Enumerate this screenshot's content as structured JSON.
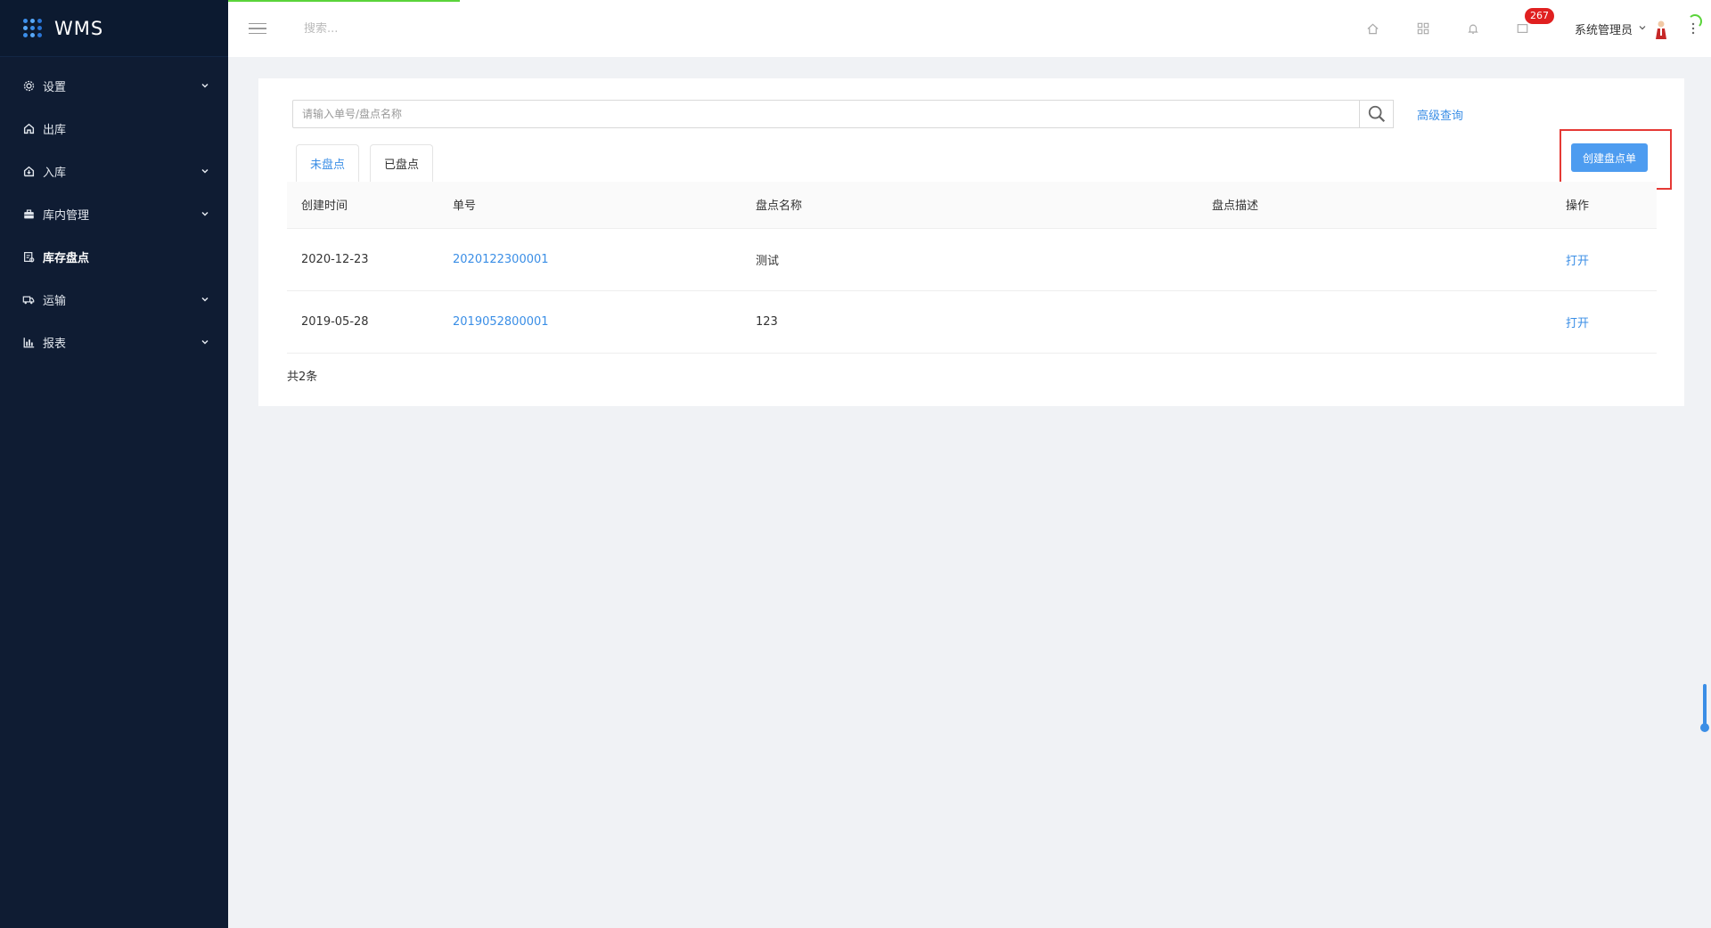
{
  "app": {
    "name": "WMS"
  },
  "sidebar": {
    "items": [
      {
        "label": "设置",
        "icon": "gear-icon",
        "expandable": true
      },
      {
        "label": "出库",
        "icon": "outbound-icon",
        "expandable": false
      },
      {
        "label": "入库",
        "icon": "inbound-icon",
        "expandable": true
      },
      {
        "label": "库内管理",
        "icon": "briefcase-icon",
        "expandable": true
      },
      {
        "label": "库存盘点",
        "icon": "inventory-check-icon",
        "expandable": false,
        "active": true
      },
      {
        "label": "运输",
        "icon": "truck-icon",
        "expandable": true
      },
      {
        "label": "报表",
        "icon": "bar-chart-icon",
        "expandable": true
      }
    ]
  },
  "topbar": {
    "search_placeholder": "搜索...",
    "notification_count": "267",
    "user_name": "系统管理员"
  },
  "main": {
    "search_placeholder": "请输入单号/盘点名称",
    "advanced_search": "高级查询",
    "create_button": "创建盘点单",
    "tabs": [
      {
        "label": "未盘点",
        "active": true
      },
      {
        "label": "已盘点",
        "active": false
      }
    ],
    "table": {
      "columns": [
        "创建时间",
        "单号",
        "盘点名称",
        "盘点描述",
        "操作"
      ],
      "rows": [
        {
          "created": "2020-12-23",
          "number": "2020122300001",
          "name": "测试",
          "desc": "",
          "action": "打开"
        },
        {
          "created": "2019-05-28",
          "number": "2019052800001",
          "name": "123",
          "desc": "",
          "action": "打开"
        }
      ]
    },
    "total_text": "共2条"
  },
  "colors": {
    "sidebar_bg": "#0f1c33",
    "accent": "#3a8ee6",
    "primary_button": "#4d9cf0",
    "badge": "#e02020",
    "highlight": "#e53935"
  }
}
